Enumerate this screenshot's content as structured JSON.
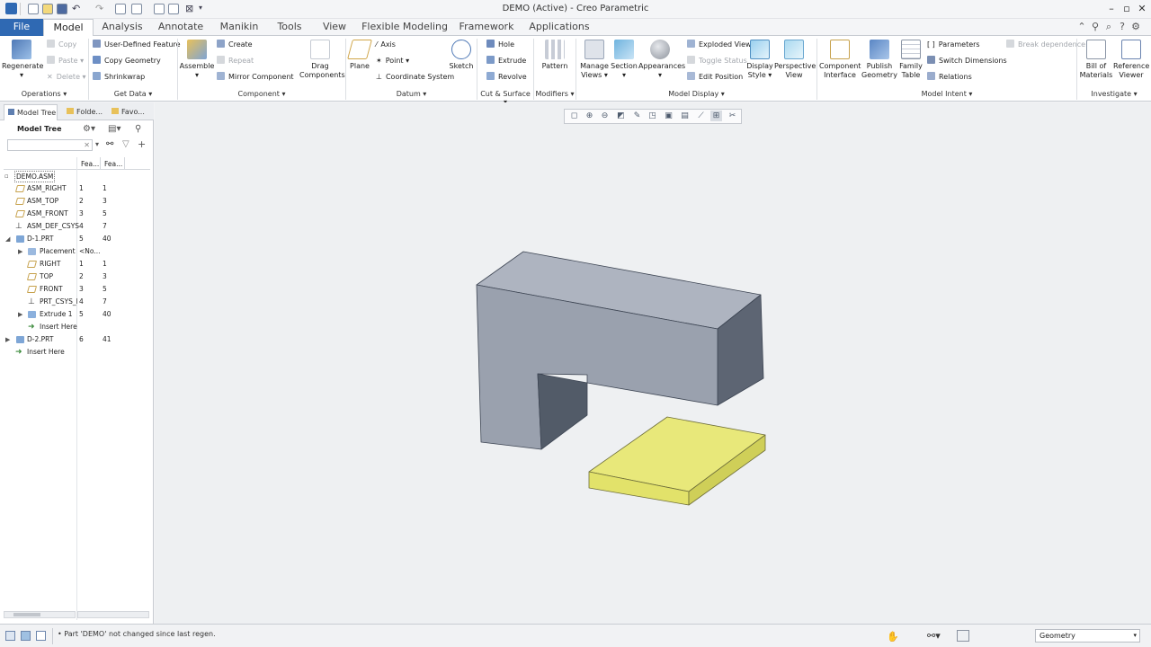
{
  "window": {
    "title": "DEMO (Active) - Creo Parametric",
    "controls": [
      "–",
      "▫",
      "✕"
    ]
  },
  "tabs": [
    {
      "label": "File"
    },
    {
      "label": "Model"
    },
    {
      "label": "Analysis"
    },
    {
      "label": "Annotate"
    },
    {
      "label": "Manikin"
    },
    {
      "label": "Tools"
    },
    {
      "label": "View"
    },
    {
      "label": "Flexible Modeling"
    },
    {
      "label": "Framework"
    },
    {
      "label": "Applications"
    }
  ],
  "ribbon": {
    "regenerate": "Regenerate",
    "copy": "Copy",
    "paste": "Paste",
    "delete": "Delete",
    "udf": "User-Defined Feature",
    "copy_geometry": "Copy Geometry",
    "shrinkwrap": "Shrinkwrap",
    "assemble": "Assemble",
    "create": "Create",
    "repeat": "Repeat",
    "mirror_component": "Mirror Component",
    "drag": "Drag",
    "components": "Components",
    "plane": "Plane",
    "axis": "Axis",
    "point": "Point",
    "coordinate_system": "Coordinate System",
    "sketch": "Sketch",
    "hole": "Hole",
    "extrude": "Extrude",
    "revolve": "Revolve",
    "pattern": "Pattern",
    "manage": "Manage",
    "views": "Views",
    "section": "Section",
    "appearances": "Appearances",
    "exploded_view": "Exploded View",
    "toggle_status": "Toggle Status",
    "edit_position": "Edit Position",
    "display": "Display",
    "style": "Style",
    "perspective": "Perspective",
    "view": "View",
    "component": "Component",
    "interface": "Interface",
    "publish": "Publish",
    "geometry": "Geometry",
    "family": "Family",
    "table": "Table",
    "parameters": "Parameters",
    "switch_dimensions": "Switch Dimensions",
    "relations": "Relations",
    "break_dependence": "Break dependence",
    "bill_of": "Bill of",
    "materials": "Materials",
    "reference": "Reference",
    "viewer": "Viewer"
  },
  "groups": {
    "operations": "Operations ▾",
    "get_data": "Get Data ▾",
    "component": "Component ▾",
    "datum": "Datum ▾",
    "cut_surface": "Cut & Surface ▾",
    "modifiers": "Modifiers ▾",
    "model_display": "Model Display ▾",
    "model_intent": "Model Intent ▾",
    "investigate": "Investigate ▾"
  },
  "panel": {
    "tabs": [
      "Model Tree",
      "Folde...",
      "Favo..."
    ],
    "header": "Model Tree",
    "col1": "Fea...",
    "col2": "Fea...",
    "rows": [
      {
        "name": "DEMO.ASM",
        "c1": "",
        "c2": ""
      },
      {
        "name": "ASM_RIGHT",
        "c1": "1",
        "c2": "1"
      },
      {
        "name": "ASM_TOP",
        "c1": "2",
        "c2": "3"
      },
      {
        "name": "ASM_FRONT",
        "c1": "3",
        "c2": "5"
      },
      {
        "name": "ASM_DEF_CSYS",
        "c1": "4",
        "c2": "7"
      },
      {
        "name": "D-1.PRT",
        "c1": "5",
        "c2": "40"
      },
      {
        "name": "Placement",
        "c1": "<No...",
        "c2": ""
      },
      {
        "name": "RIGHT",
        "c1": "1",
        "c2": "1"
      },
      {
        "name": "TOP",
        "c1": "2",
        "c2": "3"
      },
      {
        "name": "FRONT",
        "c1": "3",
        "c2": "5"
      },
      {
        "name": "PRT_CSYS_DE",
        "c1": "4",
        "c2": "7"
      },
      {
        "name": "Extrude 1",
        "c1": "5",
        "c2": "40"
      },
      {
        "name": "Insert Here",
        "c1": "",
        "c2": ""
      },
      {
        "name": "D-2.PRT",
        "c1": "6",
        "c2": "41"
      },
      {
        "name": "Insert Here",
        "c1": "",
        "c2": ""
      }
    ]
  },
  "status": {
    "message": "Part 'DEMO' not changed since last regen.",
    "filter": "Geometry"
  },
  "colors": {
    "accent": "#2f69b3",
    "part_gray": "#9aa1ae",
    "part_yellow": "#eaea7a"
  }
}
